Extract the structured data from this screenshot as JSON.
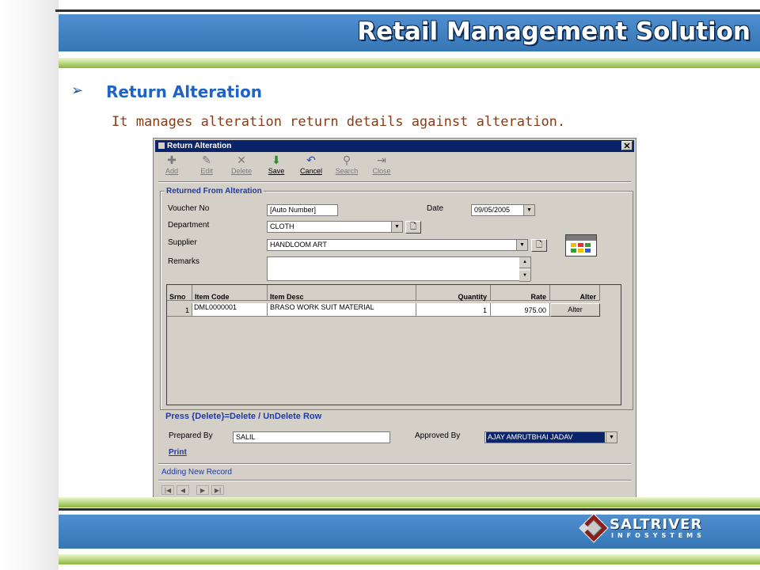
{
  "slide": {
    "title": "Retail Management Solution",
    "heading": "Return Alteration",
    "description": "It manages alteration return details against alteration.",
    "brand_name": "SALTRIVER",
    "brand_sub": "INFOSYSTEMS",
    "colors": {
      "banner": "#3f7fc0",
      "heading": "#1f63c7",
      "description": "#8a3a16",
      "green_strip": "#8ab83a"
    }
  },
  "window": {
    "title": "Return Alteration",
    "close_glyph": "✕"
  },
  "toolbar": [
    {
      "label": "Add",
      "icon": "plus-icon",
      "glyph": "✚",
      "enabled": false
    },
    {
      "label": "Edit",
      "icon": "edit-icon",
      "glyph": "✎",
      "enabled": false
    },
    {
      "label": "Delete",
      "icon": "delete-icon",
      "glyph": "✕",
      "enabled": false
    },
    {
      "label": "Save",
      "icon": "save-icon",
      "glyph": "⬇",
      "enabled": true
    },
    {
      "label": "Cancel",
      "icon": "cancel-icon",
      "glyph": "↶",
      "enabled": true
    },
    {
      "label": "Search",
      "icon": "search-icon",
      "glyph": "⚲",
      "enabled": false
    },
    {
      "label": "Close",
      "icon": "close-door-icon",
      "glyph": "⇥",
      "enabled": false
    }
  ],
  "form": {
    "group_title": "Returned From Alteration",
    "voucher_label": "Voucher No",
    "voucher_value": "[Auto Number]",
    "date_label": "Date",
    "date_value": "09/05/2005",
    "department_label": "Department",
    "department_value": "CLOTH",
    "supplier_label": "Supplier",
    "supplier_value": "HANDLOOM ART",
    "remarks_label": "Remarks",
    "remarks_value": ""
  },
  "grid": {
    "headers": {
      "srno": "Srno",
      "item_code": "Item Code",
      "item_desc": "Item Desc",
      "quantity": "Quantity",
      "rate": "Rate",
      "alter": "Alter"
    },
    "rows": [
      {
        "srno": "1",
        "item_code": "DML0000001",
        "item_desc": "BRASO WORK SUIT MATERIAL",
        "quantity": "1",
        "rate": "975.00",
        "alter": "Alter"
      }
    ]
  },
  "footer": {
    "hint": "Press {Delete}=Delete / UnDelete Row",
    "prepared_label": "Prepared By",
    "prepared_value": "SALIL",
    "approved_label": "Approved By",
    "approved_value": "AJAY AMRUTBHAI JADAV",
    "print_label": "Print",
    "status": "Adding New Record"
  },
  "navigation": [
    {
      "glyph": "|◀",
      "icon": "first-record-icon"
    },
    {
      "glyph": "◀",
      "icon": "prev-record-icon"
    },
    {
      "glyph": "▶",
      "icon": "next-record-icon"
    },
    {
      "glyph": "▶|",
      "icon": "last-record-icon"
    }
  ]
}
